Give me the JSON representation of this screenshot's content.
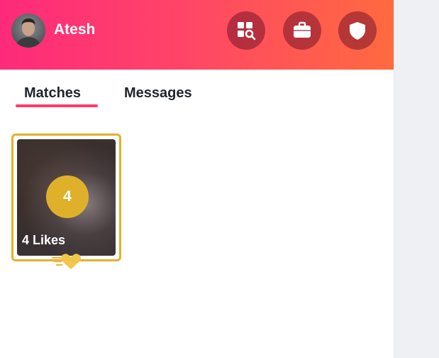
{
  "header": {
    "username": "Atesh",
    "icons": [
      "explore-icon",
      "briefcase-icon",
      "shield-icon"
    ],
    "gradient": [
      "#fd2a7a",
      "#ff6a3f"
    ]
  },
  "tabs": [
    {
      "label": "Matches",
      "active": true
    },
    {
      "label": "Messages",
      "active": false
    }
  ],
  "likes_card": {
    "count": "4",
    "label": "4 Likes",
    "accent": "#e1b22c"
  }
}
